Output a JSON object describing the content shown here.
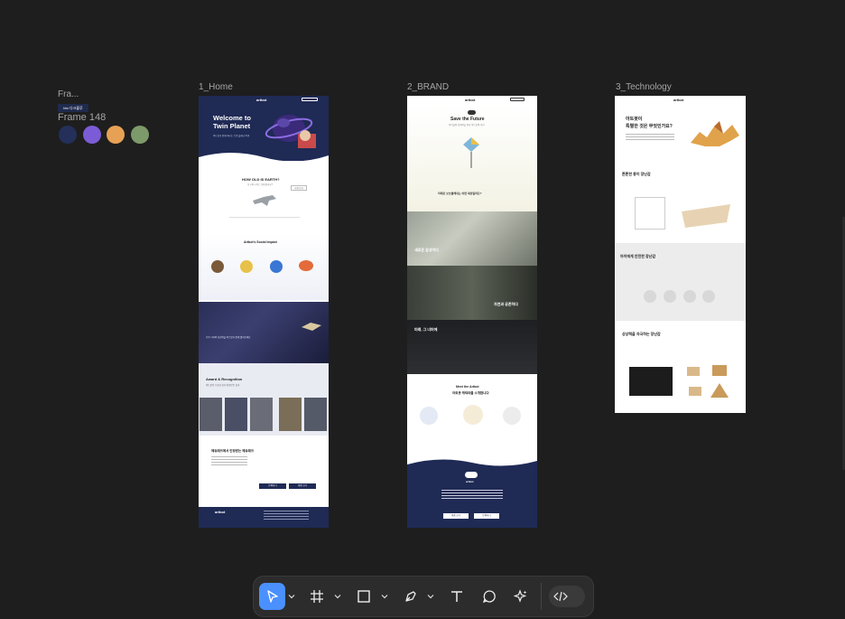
{
  "palette": {
    "label": "Fra...",
    "tag": "btn 다크블루",
    "frame_label": "Frame 148",
    "colors": [
      "#24305a",
      "#7b5cd6",
      "#e7a155",
      "#7c9a6a"
    ]
  },
  "frames": [
    {
      "label": "1_Home",
      "logo": "artbot",
      "hero_title_1": "Welcome to",
      "hero_title_2": "Twin Planet",
      "hero_sub": "아트봇과 함께 떠나는 트윈 플래닛 여행",
      "section_title": "HOW OLD IS EARTH?",
      "section_sub": "지구의 나이는 얼마일까요?",
      "button": "시대 보기",
      "system_title": "Artbot's Social Impact",
      "space_text": "우주 너머의 상상력을 아트봇과 함께 펼쳐보세요",
      "award_title": "Award & Recognition",
      "award_sub": "아트봇이 수상한 상과 인정받은 성과",
      "news_title": "에듀테크에서 인정받는 에듀테크",
      "btn1": "문의하기",
      "btn2": "제품 보기",
      "footer_logo": "artbot"
    },
    {
      "label": "2_BRAND",
      "logo": "artbot",
      "title": "Save the Future",
      "sub": "아이들의 창의력을 위한 아트봇의 미션",
      "question": "미래로 보호를해내는 어떤 세상일까요?",
      "panel1": "새로운 감성이다",
      "panel2": "자연과 공존하다",
      "panel3": "미래, 그 너머에",
      "meet_title": "Meet the Artbot",
      "meet_sub": "아트봇 캐릭터를 소개합니다",
      "footer_logo": "artbot",
      "btn1": "제품 보기",
      "btn2": "문의하기"
    },
    {
      "label": "3_Technology",
      "logo": "artbot",
      "q_title_1": "아트봇이",
      "q_title_2": "특별한 것은 무엇인가요?",
      "s1_title": "튼튼한 종이 장난감",
      "s2_title": "아이에게 안전한 장난감",
      "s3_title": "상상력을 자극하는 장난감"
    }
  ],
  "toolbar": {
    "tools": [
      "move-tool",
      "frame-tool",
      "shape-tool",
      "pen-tool",
      "text-tool",
      "comment-tool",
      "actions-tool",
      "dev-mode-toggle"
    ]
  }
}
